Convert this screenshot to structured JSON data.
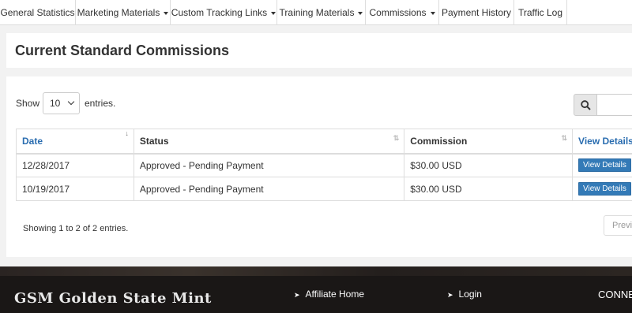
{
  "nav": {
    "items": [
      {
        "label": "General Statistics",
        "dropdown": false
      },
      {
        "label": "Marketing Materials",
        "dropdown": true
      },
      {
        "label": "Custom Tracking Links",
        "dropdown": true
      },
      {
        "label": "Training Materials",
        "dropdown": true
      },
      {
        "label": "Commissions",
        "dropdown": true
      },
      {
        "label": "Payment History",
        "dropdown": false
      },
      {
        "label": "Traffic Log",
        "dropdown": false
      }
    ]
  },
  "page": {
    "title": "Current Standard Commissions"
  },
  "table_controls": {
    "show_label": "Show",
    "page_length": "10",
    "entries_label": "entries.",
    "search_icon": "search-icon"
  },
  "table": {
    "headers": [
      "Date",
      "Status",
      "Commission",
      "View Details"
    ],
    "rows": [
      {
        "date": "12/28/2017",
        "status": "Approved - Pending Payment",
        "commission": "$30.00 USD",
        "action": "View Details"
      },
      {
        "date": "10/19/2017",
        "status": "Approved - Pending Payment",
        "commission": "$30.00 USD",
        "action": "View Details"
      }
    ],
    "info": "Showing 1 to 2 of 2 entries.",
    "prev_label": "Previ"
  },
  "footer": {
    "logo_text": "GSM Golden State Mint",
    "links": [
      "Affiliate Home",
      "Login"
    ],
    "connect": "CONNE"
  },
  "colors": {
    "link_blue": "#2a6db0",
    "button_blue": "#337ab7",
    "footer_bg": "#1a1716"
  }
}
